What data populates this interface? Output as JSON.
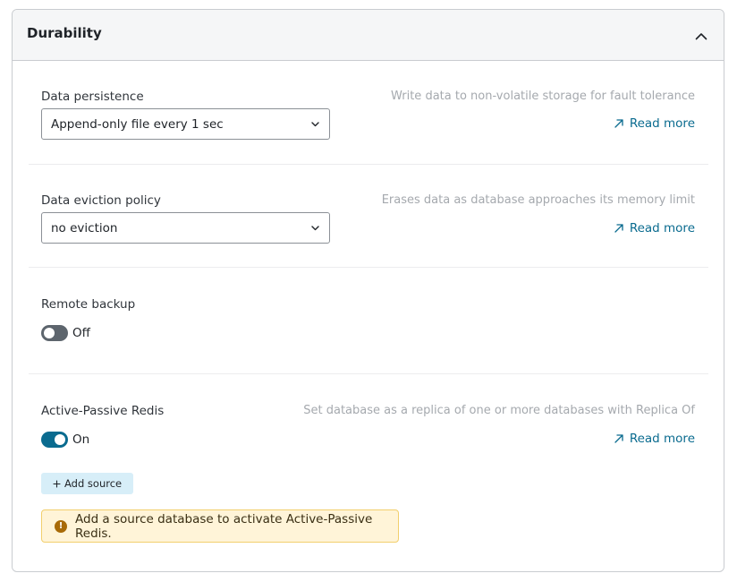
{
  "panel": {
    "title": "Durability"
  },
  "persistence": {
    "label": "Data persistence",
    "description": "Write data to non-volatile storage for fault tolerance",
    "value": "Append-only file every 1 sec",
    "read_more": "Read more"
  },
  "eviction": {
    "label": "Data eviction policy",
    "description": "Erases data as database approaches its memory limit",
    "value": "no eviction",
    "read_more": "Read more"
  },
  "backup": {
    "label": "Remote backup",
    "state": "Off"
  },
  "active_passive": {
    "label": "Active-Passive Redis",
    "description": "Set database as a replica of one or more databases with Replica Of",
    "state": "On",
    "read_more": "Read more",
    "add_source": "Add source",
    "alert": "Add a source database to activate Active-Passive Redis."
  },
  "colors": {
    "accent": "#0a6b8f",
    "toggle_off": "#5d656d",
    "alert_bg": "#fff4d8",
    "alert_border": "#f2cf6d",
    "button_bg": "#d7eef8"
  },
  "icons": {
    "collapse": "chevron-up-icon",
    "select": "chevron-down-icon",
    "read_more": "external-arrow-icon",
    "add": "plus-icon",
    "alert": "exclamation-circle-icon"
  }
}
